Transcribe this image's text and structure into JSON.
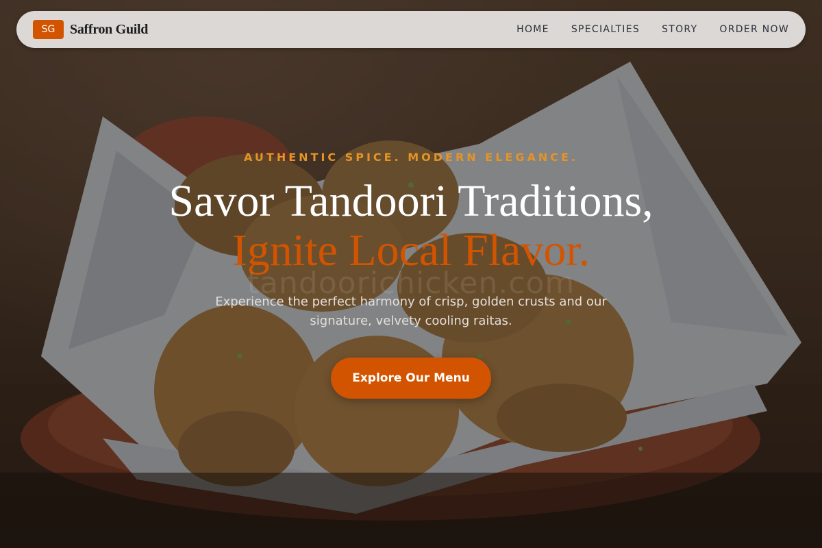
{
  "brand": {
    "badge": "SG",
    "name": "Saffron Guild"
  },
  "nav": {
    "items": [
      {
        "label": "HOME"
      },
      {
        "label": "SPECIALTIES"
      },
      {
        "label": "STORY"
      },
      {
        "label": "ORDER NOW"
      }
    ]
  },
  "hero": {
    "eyebrow": "AUTHENTIC SPICE. MODERN ELEGANCE.",
    "headline_line1": "Savor Tandoori Traditions,",
    "headline_line2": "Ignite Local Flavor.",
    "watermark": "tandoorichicken.com",
    "subtext": "Experience the perfect harmony of crisp, golden crusts and our signature, velvety cooling raitas.",
    "cta_label": "Explore Our Menu",
    "image_subject": "fried samosas in a clay bowl lined with paper napkin"
  },
  "colors": {
    "accent": "#d35400",
    "eyebrow": "#e59426",
    "nav_background": "#dcd8d5",
    "headline": "#ffffff"
  }
}
